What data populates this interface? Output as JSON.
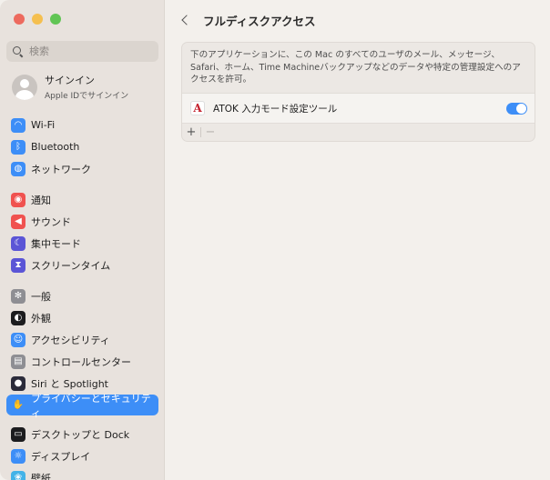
{
  "search": {
    "placeholder": "検索"
  },
  "account": {
    "name": "サインイン",
    "sub": "Apple IDでサインイン"
  },
  "sidebar": {
    "groups": [
      [
        {
          "label": "Wi-Fi",
          "icon": "wifi-icon",
          "color": "#3d8ef7"
        },
        {
          "label": "Bluetooth",
          "icon": "bluetooth-icon",
          "color": "#3d8ef7"
        },
        {
          "label": "ネットワーク",
          "icon": "globe-icon",
          "color": "#3d8ef7"
        }
      ],
      [
        {
          "label": "通知",
          "icon": "bell-icon",
          "color": "#f0524f"
        },
        {
          "label": "サウンド",
          "icon": "speaker-icon",
          "color": "#f0524f"
        },
        {
          "label": "集中モード",
          "icon": "moon-icon",
          "color": "#5b55d6"
        },
        {
          "label": "スクリーンタイム",
          "icon": "hourglass-icon",
          "color": "#5b55d6"
        }
      ],
      [
        {
          "label": "一般",
          "icon": "gear-icon",
          "color": "#8e8e93"
        },
        {
          "label": "外観",
          "icon": "appearance-icon",
          "color": "#1c1c1e"
        },
        {
          "label": "アクセシビリティ",
          "icon": "accessibility-icon",
          "color": "#3d8ef7"
        },
        {
          "label": "コントロールセンター",
          "icon": "control-center-icon",
          "color": "#8e8e93"
        },
        {
          "label": "Siri と Spotlight",
          "icon": "siri-icon",
          "color": "#2b2b3a"
        },
        {
          "label": "プライバシーとセキュリティ",
          "icon": "hand-icon",
          "color": "#3d8ef7",
          "selected": true
        }
      ],
      [
        {
          "label": "デスクトップと Dock",
          "icon": "dock-icon",
          "color": "#1c1c1e"
        },
        {
          "label": "ディスプレイ",
          "icon": "display-icon",
          "color": "#3d8ef7"
        },
        {
          "label": "壁紙",
          "icon": "wallpaper-icon",
          "color": "#43b3e8"
        }
      ]
    ]
  },
  "header": {
    "title": "フルディスクアクセス"
  },
  "panel": {
    "description": "下のアプリケーションに、この Mac のすべてのユーザのメール、メッセージ、Safari、ホーム、Time Machineバックアップなどのデータや特定の管理設定へのアクセスを許可。",
    "apps": [
      {
        "name": "ATOK 入力モード設定ツール",
        "icon_letter": "A",
        "enabled": true
      }
    ],
    "add_label": "+",
    "remove_label": "−"
  }
}
